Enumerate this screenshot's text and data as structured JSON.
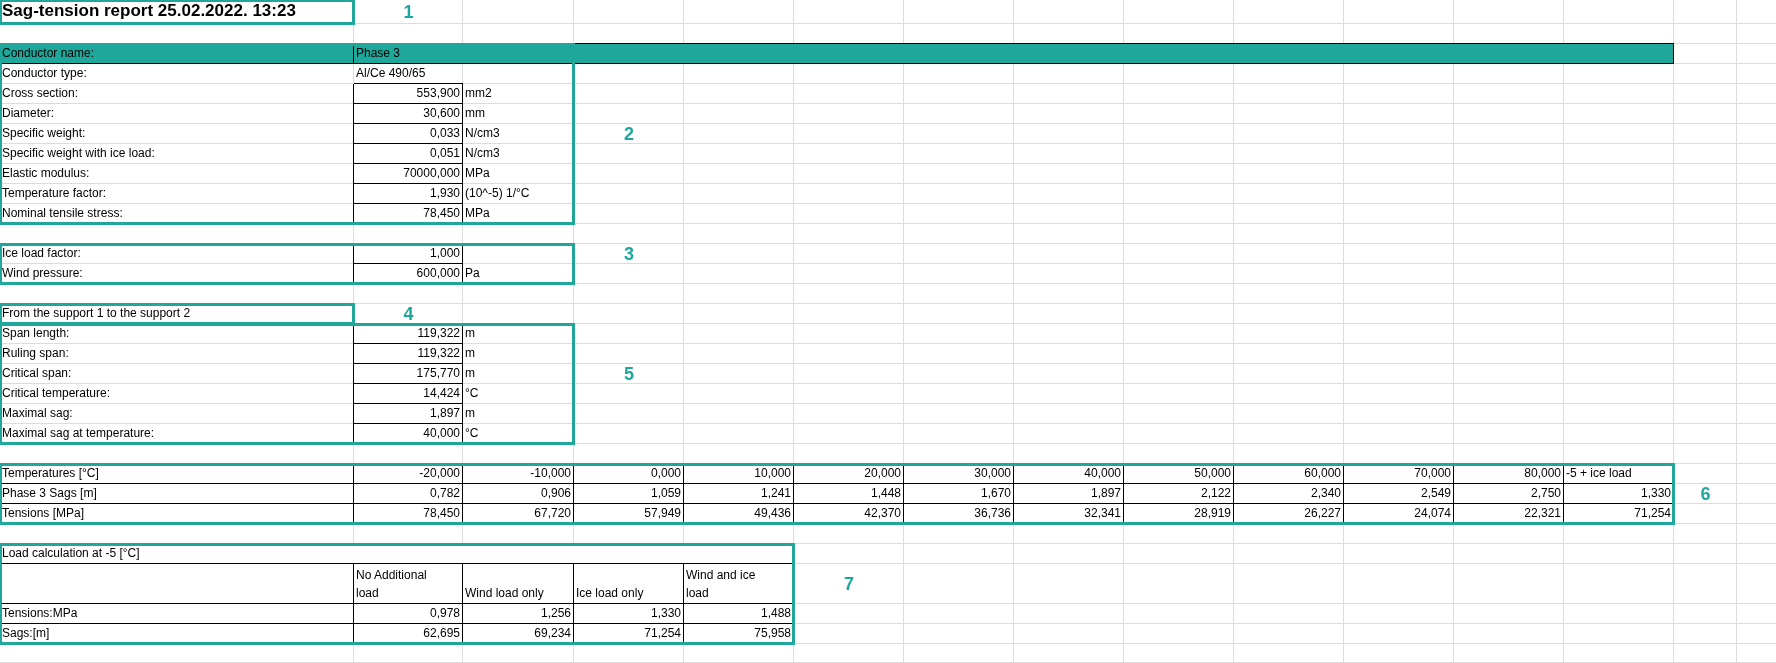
{
  "title": "Sag-tension report 25.02.2022. 13:23",
  "conductor": {
    "name_label": "Conductor name:",
    "name": "Phase 3",
    "type_label": "Conductor type:",
    "type": "Al/Ce 490/65",
    "properties": [
      {
        "label": "Cross section:",
        "value": "553,900",
        "unit": "mm2"
      },
      {
        "label": "Diameter:",
        "value": "30,600",
        "unit": "mm"
      },
      {
        "label": "Specific weight:",
        "value": "0,033",
        "unit": "N/cm3"
      },
      {
        "label": "Specific weight with ice load:",
        "value": "0,051",
        "unit": "N/cm3"
      },
      {
        "label": "Elastic modulus:",
        "value": "70000,000",
        "unit": "MPa"
      },
      {
        "label": "Temperature factor:",
        "value": "1,930",
        "unit": "(10^-5) 1/°C"
      },
      {
        "label": "Nominal tensile stress:",
        "value": "78,450",
        "unit": "MPa"
      }
    ]
  },
  "loads": [
    {
      "label": "Ice load factor:",
      "value": "1,000"
    },
    {
      "label": "Wind pressure:",
      "value": "600,000",
      "unit": "Pa"
    }
  ],
  "span_heading": "From the support 1 to the support 2",
  "span": [
    {
      "label": "Span length:",
      "value": "119,322",
      "unit": "m"
    },
    {
      "label": "Ruling span:",
      "value": "119,322",
      "unit": "m"
    },
    {
      "label": "Critical span:",
      "value": "175,770",
      "unit": "m"
    },
    {
      "label": "Critical temperature:",
      "value": "14,424",
      "unit": "°C"
    },
    {
      "label": "Maximal sag:",
      "value": "1,897",
      "unit": "m"
    },
    {
      "label": "Maximal sag at temperature:",
      "value": "40,000",
      "unit": "°C"
    }
  ],
  "sag_table": {
    "rows": [
      {
        "kind": "header",
        "label": "Temperatures [°C]",
        "cells": [
          "-20,000",
          "-10,000",
          "0,000",
          "10,000",
          "20,000",
          "30,000",
          "40,000",
          "50,000",
          "60,000",
          "70,000",
          "80,000",
          "-5 + ice load"
        ]
      },
      {
        "kind": "data",
        "label": "Phase 3 Sags [m]",
        "cells": [
          "0,782",
          "0,906",
          "1,059",
          "1,241",
          "1,448",
          "1,670",
          "1,897",
          "2,122",
          "2,340",
          "2,549",
          "2,750",
          "1,330"
        ]
      },
      {
        "kind": "data",
        "label": "Tensions [MPa]",
        "cells": [
          "78,450",
          "67,720",
          "57,949",
          "49,436",
          "42,370",
          "36,736",
          "32,341",
          "28,919",
          "26,227",
          "24,074",
          "22,321",
          "71,254"
        ]
      }
    ]
  },
  "load_table": {
    "title": "Load calculation at -5 [°C]",
    "columns": [
      "No Additional load",
      "Wind load only",
      "Ice load only",
      "Wind and ice load"
    ],
    "rows": [
      {
        "label": "Tensions:MPa",
        "values": [
          "0,978",
          "1,256",
          "1,330",
          "1,488"
        ]
      },
      {
        "label": "Sags:[m]",
        "values": [
          "62,695",
          "69,234",
          "71,254",
          "75,958"
        ]
      }
    ]
  },
  "annotations": [
    {
      "number": "1"
    },
    {
      "number": "2"
    },
    {
      "number": "3"
    },
    {
      "number": "4"
    },
    {
      "number": "5"
    },
    {
      "number": "6"
    },
    {
      "number": "7"
    }
  ]
}
